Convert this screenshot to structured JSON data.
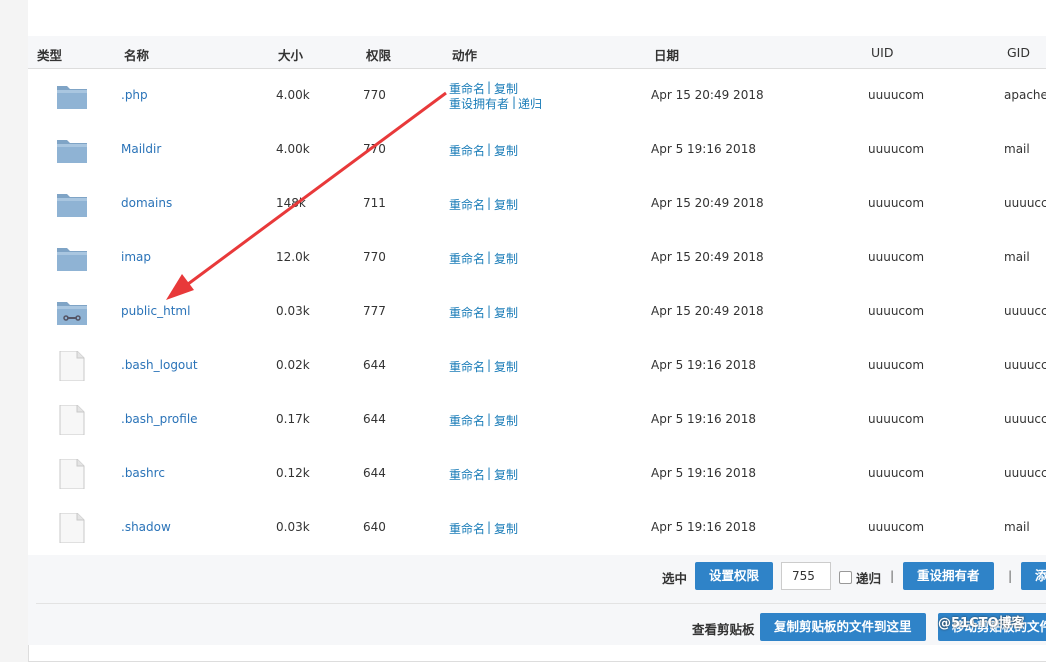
{
  "headers": {
    "type": "类型",
    "name": "名称",
    "size": "大小",
    "perm": "权限",
    "action": "动作",
    "date": "日期",
    "uid": "UID",
    "gid": "GID"
  },
  "rows": [
    {
      "kind": "folder",
      "name": ".php",
      "size": "4.00k",
      "perm": "770",
      "rename": "重命名",
      "copy": "复制",
      "chown": "重设拥有者",
      "recursive": "递归",
      "date": "Apr 15 20:49 2018",
      "uid": "uuuucom",
      "gid": "apache"
    },
    {
      "kind": "folder",
      "name": "Maildir",
      "size": "4.00k",
      "perm": "770",
      "rename": "重命名",
      "copy": "复制",
      "date": "Apr 5 19:16 2018",
      "uid": "uuuucom",
      "gid": "mail"
    },
    {
      "kind": "folder",
      "name": "domains",
      "size": "148k",
      "perm": "711",
      "rename": "重命名",
      "copy": "复制",
      "date": "Apr 15 20:49 2018",
      "uid": "uuuucom",
      "gid": "uuuucc"
    },
    {
      "kind": "folder",
      "name": "imap",
      "size": "12.0k",
      "perm": "770",
      "rename": "重命名",
      "copy": "复制",
      "date": "Apr 15 20:49 2018",
      "uid": "uuuucom",
      "gid": "mail"
    },
    {
      "kind": "folder-link",
      "name": "public_html",
      "size": "0.03k",
      "perm": "777",
      "rename": "重命名",
      "copy": "复制",
      "date": "Apr 15 20:49 2018",
      "uid": "uuuucom",
      "gid": "uuuucc"
    },
    {
      "kind": "file",
      "name": ".bash_logout",
      "size": "0.02k",
      "perm": "644",
      "rename": "重命名",
      "copy": "复制",
      "date": "Apr 5 19:16 2018",
      "uid": "uuuucom",
      "gid": "uuuucc"
    },
    {
      "kind": "file",
      "name": ".bash_profile",
      "size": "0.17k",
      "perm": "644",
      "rename": "重命名",
      "copy": "复制",
      "date": "Apr 5 19:16 2018",
      "uid": "uuuucom",
      "gid": "uuuucc"
    },
    {
      "kind": "file",
      "name": ".bashrc",
      "size": "0.12k",
      "perm": "644",
      "rename": "重命名",
      "copy": "复制",
      "date": "Apr 5 19:16 2018",
      "uid": "uuuucom",
      "gid": "uuuucc"
    },
    {
      "kind": "file",
      "name": ".shadow",
      "size": "0.03k",
      "perm": "640",
      "rename": "重命名",
      "copy": "复制",
      "date": "Apr 5 19:16 2018",
      "uid": "uuuucom",
      "gid": "mail"
    }
  ],
  "separator": " | ",
  "footer": {
    "selected_label": "选中",
    "set_perm_btn": "设置权限",
    "perm_value": "755",
    "recursive_label": "递归",
    "pipe": "|",
    "reset_owner_btn": "重设拥有者",
    "more_btn": "添",
    "view_clipboard_label": "查看剪贴板",
    "copy_here_btn": "复制剪贴板的文件到这里",
    "move_here_btn": "移动剪贴板的文件"
  },
  "watermark": "@51CTO博客",
  "colors": {
    "link": "#2a73b8",
    "button": "#2f83c8",
    "arrow": "#e8393a"
  }
}
